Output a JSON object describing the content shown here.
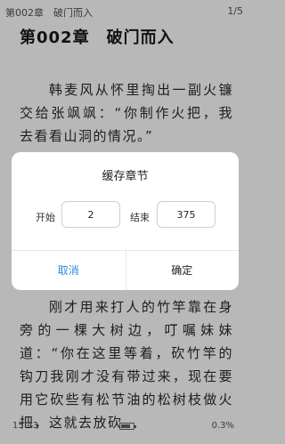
{
  "header": {
    "chapter_small": "第002章　破门而入",
    "page_count": "1/5"
  },
  "content": {
    "chapter_title": "第002章　破门而入",
    "paragraph_1": "韩麦风从怀里掏出一副火镰交给张飒飒：“你制作火把，我去看看山洞的情况。”",
    "paragraph_2": "刚才用来打人的竹竿靠在身旁的一棵大树边，叮嘱妹妹道：“你在这里等着，砍竹竿的钩刀我刚才没有带过来，现在要用它砍些有松节油的松树枝做火把，这就去放砍"
  },
  "footer": {
    "time": "15:43",
    "battery_level": 0.8,
    "progress": "0.3%"
  },
  "dialog": {
    "title": "缓存章节",
    "start_label": "开始",
    "start_value": "2",
    "end_label": "结束",
    "end_value": "375",
    "cancel_label": "取消",
    "confirm_label": "确定"
  },
  "colors": {
    "accent": "#2b8ce0",
    "page_background": "#b8b8b8",
    "dialog_background": "#ffffff"
  }
}
